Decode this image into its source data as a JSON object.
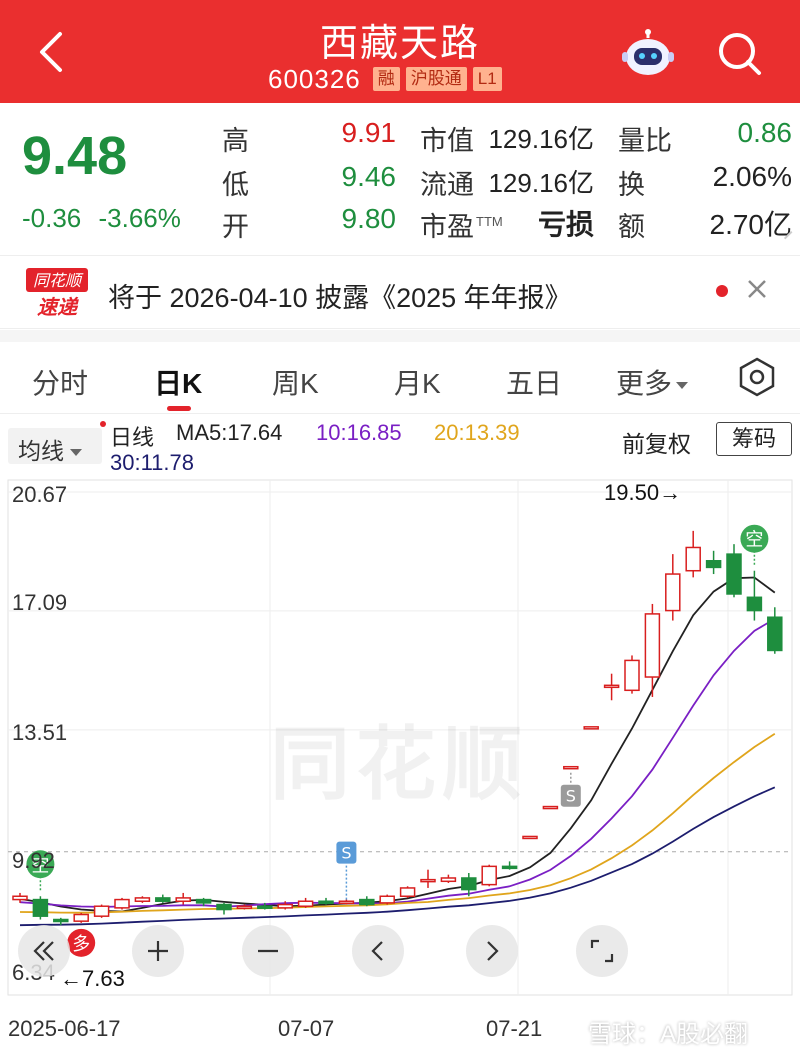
{
  "header": {
    "title": "西藏天路",
    "code": "600326",
    "tags": [
      "融",
      "沪股通",
      "L1"
    ]
  },
  "quote": {
    "price": "9.48",
    "change": "-0.36",
    "change_pct": "-3.66%",
    "rows": [
      {
        "l1": "高",
        "v1": "9.91",
        "l2": "市值",
        "v2": "129.16亿",
        "l3": "量比",
        "v3": "0.86"
      },
      {
        "l1": "低",
        "v1": "9.46",
        "l2": "流通",
        "v2": "129.16亿",
        "l3": "换",
        "v3": "2.06%"
      },
      {
        "l1": "开",
        "v1": "9.80",
        "l2": "市盈",
        "v2_sup": "TTM",
        "v2": "亏损",
        "l3": "额",
        "v3": "2.70亿"
      }
    ],
    "colors": {
      "up": "#d81e1e",
      "down": "#1e8e3e"
    }
  },
  "notice": {
    "logo_top": "同花顺",
    "logo_bottom": "速递",
    "text": "将于 2026-04-10 披露《2025 年年报》"
  },
  "tabs": [
    "分时",
    "日K",
    "周K",
    "月K",
    "五日",
    "更多"
  ],
  "ma": {
    "toggle": "均线",
    "period": "日线",
    "ma5": "MA5:17.64",
    "ma10": "10:16.85",
    "ma20": "20:13.39",
    "ma30": "30:11.78",
    "restore": "前复权",
    "chips": "筹码",
    "colors": {
      "ma5": "#222222",
      "ma10": "#7a1fc4",
      "ma20": "#e0a51c",
      "ma30": "#1d1d6e"
    }
  },
  "chart_data": {
    "type": "candlestick",
    "y_ticks": [
      "20.67",
      "17.09",
      "13.51",
      "9.92",
      "6.34"
    ],
    "ylim": [
      6.34,
      20.67
    ],
    "x_ticks": [
      "2025-06-17",
      "07-07",
      "07-21"
    ],
    "reference_price": 9.84,
    "annotations": {
      "high": "19.50",
      "low": "7.63",
      "high_marker": "→",
      "low_marker": "←"
    },
    "signals": [
      {
        "label": "空",
        "kind": "sell-bubble",
        "index": 1
      },
      {
        "label": "S",
        "kind": "s-flag",
        "index": 16
      },
      {
        "label": "S",
        "kind": "s-flag",
        "index": 27
      },
      {
        "label": "空",
        "kind": "sell-bubble",
        "index": 36
      },
      {
        "label": "多",
        "kind": "buy-bubble",
        "index": 3
      }
    ],
    "candles": [
      {
        "o": 8.4,
        "c": 8.5,
        "h": 8.6,
        "l": 8.3
      },
      {
        "o": 8.4,
        "c": 7.9,
        "h": 8.5,
        "l": 7.8
      },
      {
        "o": 7.8,
        "c": 7.75,
        "h": 7.85,
        "l": 7.63
      },
      {
        "o": 7.75,
        "c": 7.95,
        "h": 8.0,
        "l": 7.7
      },
      {
        "o": 7.9,
        "c": 8.2,
        "h": 8.25,
        "l": 7.85
      },
      {
        "o": 8.15,
        "c": 8.4,
        "h": 8.45,
        "l": 8.1
      },
      {
        "o": 8.35,
        "c": 8.45,
        "h": 8.5,
        "l": 8.3
      },
      {
        "o": 8.45,
        "c": 8.35,
        "h": 8.55,
        "l": 8.3
      },
      {
        "o": 8.35,
        "c": 8.45,
        "h": 8.6,
        "l": 8.25
      },
      {
        "o": 8.4,
        "c": 8.3,
        "h": 8.45,
        "l": 8.2
      },
      {
        "o": 8.25,
        "c": 8.1,
        "h": 8.3,
        "l": 7.95
      },
      {
        "o": 8.15,
        "c": 8.2,
        "h": 8.25,
        "l": 8.1
      },
      {
        "o": 8.2,
        "c": 8.15,
        "h": 8.3,
        "l": 8.1
      },
      {
        "o": 8.15,
        "c": 8.25,
        "h": 8.35,
        "l": 8.1
      },
      {
        "o": 8.2,
        "c": 8.35,
        "h": 8.45,
        "l": 8.15
      },
      {
        "o": 8.35,
        "c": 8.3,
        "h": 8.45,
        "l": 8.25
      },
      {
        "o": 8.3,
        "c": 8.35,
        "h": 8.4,
        "l": 8.25
      },
      {
        "o": 8.4,
        "c": 8.25,
        "h": 8.5,
        "l": 8.2
      },
      {
        "o": 8.3,
        "c": 8.5,
        "h": 8.55,
        "l": 8.25
      },
      {
        "o": 8.5,
        "c": 8.75,
        "h": 8.8,
        "l": 8.45
      },
      {
        "o": 9.0,
        "c": 9.0,
        "h": 9.3,
        "l": 8.75
      },
      {
        "o": 8.95,
        "c": 9.05,
        "h": 9.15,
        "l": 8.9
      },
      {
        "o": 9.05,
        "c": 8.7,
        "h": 9.2,
        "l": 8.5
      },
      {
        "o": 8.85,
        "c": 9.4,
        "h": 9.45,
        "l": 8.8
      },
      {
        "o": 9.4,
        "c": 9.35,
        "h": 9.55,
        "l": 9.3
      },
      {
        "o": 10.3,
        "c": 10.3,
        "h": 10.3,
        "l": 10.3
      },
      {
        "o": 11.2,
        "c": 11.2,
        "h": 11.2,
        "l": 11.2
      },
      {
        "o": 12.4,
        "c": 12.4,
        "h": 12.4,
        "l": 12.4
      },
      {
        "o": 13.6,
        "c": 13.6,
        "h": 13.6,
        "l": 13.6
      },
      {
        "o": 14.85,
        "c": 14.85,
        "h": 15.2,
        "l": 14.4
      },
      {
        "o": 14.7,
        "c": 15.6,
        "h": 15.75,
        "l": 14.6
      },
      {
        "o": 15.1,
        "c": 17.0,
        "h": 17.3,
        "l": 14.5
      },
      {
        "o": 17.1,
        "c": 18.2,
        "h": 18.8,
        "l": 16.8
      },
      {
        "o": 18.3,
        "c": 19.0,
        "h": 19.5,
        "l": 18.1
      },
      {
        "o": 18.6,
        "c": 18.4,
        "h": 18.9,
        "l": 18.2
      },
      {
        "o": 18.8,
        "c": 17.6,
        "h": 19.1,
        "l": 17.5
      },
      {
        "o": 17.5,
        "c": 17.1,
        "h": 18.3,
        "l": 16.8
      },
      {
        "o": 16.9,
        "c": 15.9,
        "h": 17.2,
        "l": 15.8
      }
    ],
    "ma_end": {
      "ma5": 17.64,
      "ma10": 16.85,
      "ma20": 13.39,
      "ma30": 11.78
    }
  },
  "controls": [
    "rewind",
    "zoom-in",
    "zoom-out",
    "prev",
    "next",
    "fullscreen"
  ],
  "watermarks": {
    "center": "同花顺",
    "corner": "雪球：A股必翻"
  }
}
